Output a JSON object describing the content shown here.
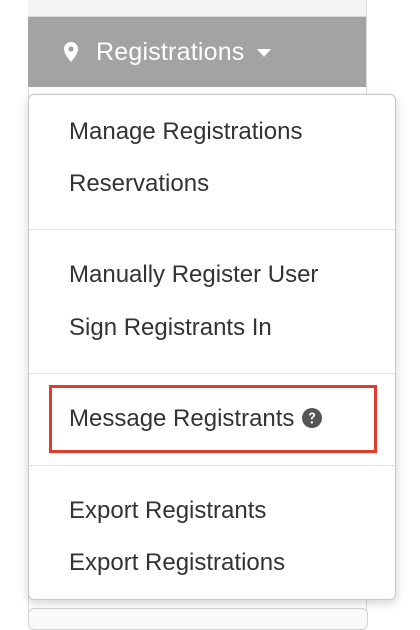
{
  "dropdown": {
    "label": "Registrations",
    "icon": "map-pin-icon",
    "caret_icon": "caret-down-icon",
    "background": "#a3a3a3"
  },
  "menu": {
    "groups": [
      {
        "items": [
          {
            "label": "Manage Registrations"
          },
          {
            "label": "Reservations"
          }
        ]
      },
      {
        "items": [
          {
            "label": "Manually Register User"
          },
          {
            "label": "Sign Registrants In"
          }
        ]
      },
      {
        "items": [
          {
            "label": "Message Registrants",
            "icon": "help-circle-icon",
            "highlighted": true
          }
        ]
      },
      {
        "items": [
          {
            "label": "Export Registrants"
          },
          {
            "label": "Export Registrations"
          }
        ]
      }
    ],
    "highlight_color": "#e13b2b"
  }
}
